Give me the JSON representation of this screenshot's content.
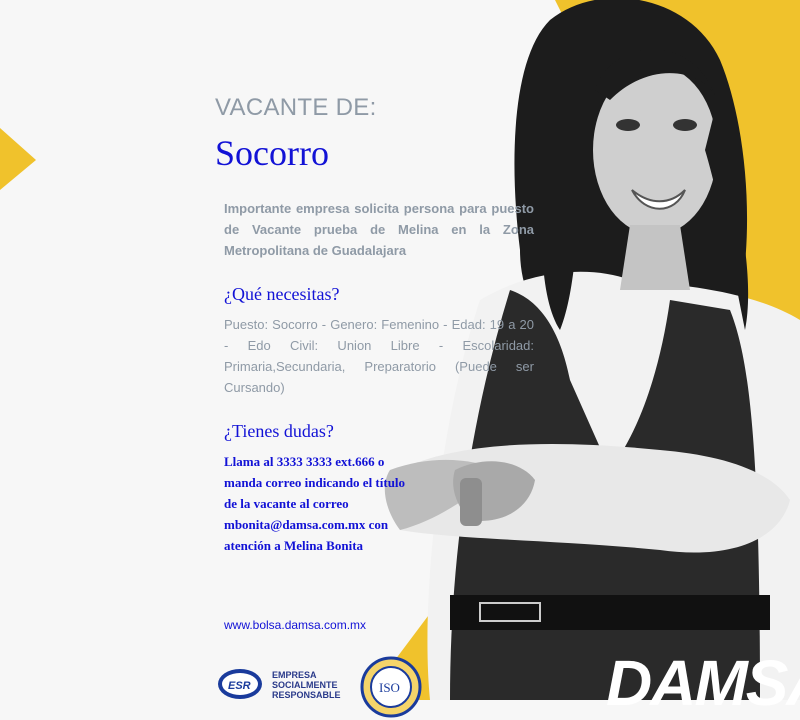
{
  "colors": {
    "accent_yellow": "#f0c22c",
    "title_blue": "#1212d6",
    "gray_text": "#8f9aa6"
  },
  "header": {
    "vacancy_label": "VACANTE DE:",
    "job_title": "Socorro"
  },
  "description": "Importante empresa solicita persona para puesto de Vacante prueba de Melina en la Zona Metropolitana de Guadalajara",
  "requirements": {
    "heading": "¿Qué necesitas?",
    "text": "Puesto: Socorro - Genero: Femenino - Edad: 19 a 20 - Edo Civil: Union Libre - Escolaridad: Primaria,Secundaria, Preparatorio (Puede ser Cursando)"
  },
  "contact": {
    "heading": "¿Tienes dudas?",
    "lines": [
      "Llama al 3333 3333 ext.666 o",
      "manda correo indicando el título",
      "de la vacante al correo",
      "mbonita@damsa.com.mx con",
      "atención a Melina Bonita"
    ]
  },
  "website": "www.bolsa.damsa.com.mx",
  "logos": {
    "esr_badge": "ESR",
    "esr_text": [
      "EMPRESA",
      "SOCIALMENTE",
      "RESPONSABLE"
    ],
    "iso_badge": "ISO",
    "brand": "DAMSA"
  },
  "icons": {
    "person_photo": "businesswoman-photo",
    "esr": "esr-logo",
    "iso": "iso-seal"
  }
}
